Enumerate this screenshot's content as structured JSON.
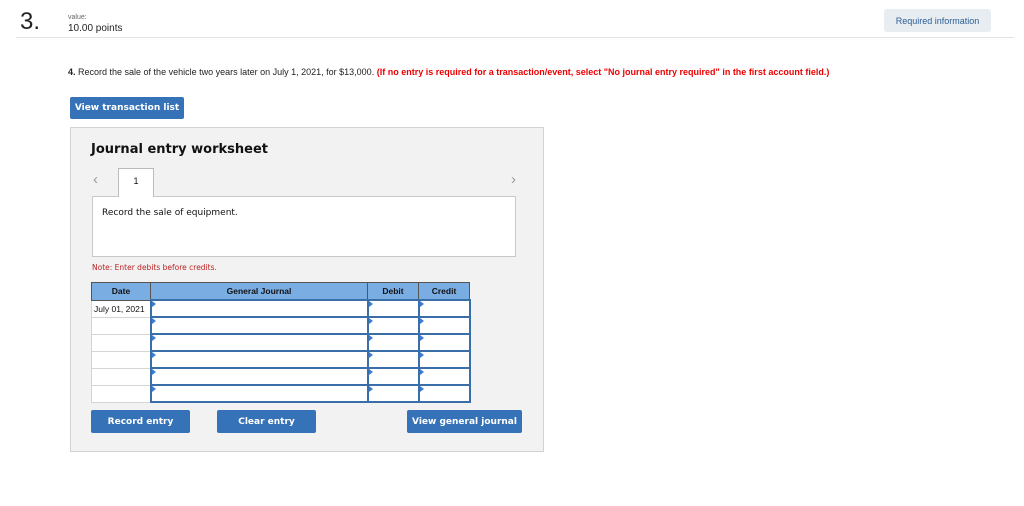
{
  "header": {
    "question_number": "3.",
    "value_label": "value:",
    "points": "10.00 points",
    "required_info_button": "Required information"
  },
  "question": {
    "number": "4.",
    "text": " Record the sale of the vehicle two years later on July 1, 2021, for $13,000. ",
    "instruction": "(If no entry is required for a transaction/event, select \"No journal entry required\" in the first account field.)"
  },
  "view_transaction_list_button": "View transaction list",
  "worksheet": {
    "title": "Journal entry worksheet",
    "prev_icon": "‹",
    "next_icon": "›",
    "current_tab": "1",
    "description": "Record the sale of equipment.",
    "note": "Note: Enter debits before credits.",
    "columns": [
      "Date",
      "General Journal",
      "Debit",
      "Credit"
    ],
    "rows": [
      {
        "date": "July 01, 2021",
        "account": "",
        "debit": "",
        "credit": ""
      },
      {
        "date": "",
        "account": "",
        "debit": "",
        "credit": ""
      },
      {
        "date": "",
        "account": "",
        "debit": "",
        "credit": ""
      },
      {
        "date": "",
        "account": "",
        "debit": "",
        "credit": ""
      },
      {
        "date": "",
        "account": "",
        "debit": "",
        "credit": ""
      },
      {
        "date": "",
        "account": "",
        "debit": "",
        "credit": ""
      }
    ],
    "buttons": {
      "record": "Record entry",
      "clear": "Clear entry",
      "view_journal": "View general journal"
    }
  }
}
